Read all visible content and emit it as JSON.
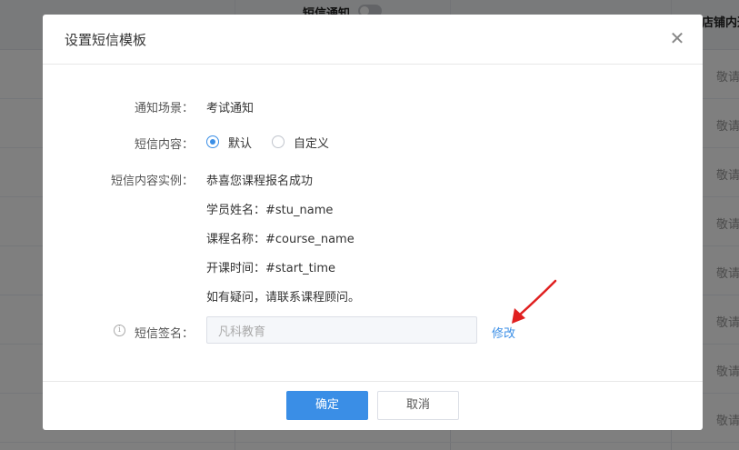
{
  "background": {
    "columns": [
      {
        "title": "短信通知",
        "toggle": true
      },
      {
        "title": "店铺内通",
        "toggle": false
      }
    ],
    "row_cell_text": "敬请"
  },
  "dialog": {
    "title": "设置短信模板",
    "close_icon": "close-icon",
    "fields": {
      "scene_label": "通知场景：",
      "scene_value": "考试通知",
      "content_label": "短信内容：",
      "options": [
        {
          "label": "默认",
          "checked": true
        },
        {
          "label": "自定义",
          "checked": false
        }
      ],
      "example_label": "短信内容实例：",
      "example_lines": [
        "恭喜您课程报名成功",
        "学员姓名：#stu_name",
        "课程名称：#course_name",
        "开课时间：#start_time",
        "如有疑问，请联系课程顾问。"
      ],
      "signature_label": "短信签名：",
      "signature_value": "凡科教育",
      "edit_link": "修改"
    },
    "buttons": {
      "ok": "确定",
      "cancel": "取消"
    }
  },
  "colors": {
    "primary": "#3a8ee6",
    "annotation_arrow": "#e02020"
  }
}
